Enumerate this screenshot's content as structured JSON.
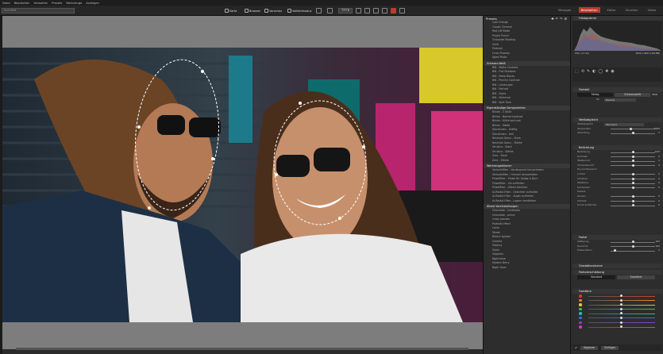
{
  "menu": [
    "Datei",
    "Bearbeiten",
    "Verwalten",
    "Presets",
    "Werkzeuge",
    "Anzeigen"
  ],
  "search": {
    "placeholder": "Suchfeld"
  },
  "toolbar": {
    "karte": "Karte",
    "browser": "Browser",
    "vorschau": "Vorschau",
    "vollbild": "Vollbildmodus",
    "zoom": "TTTTB"
  },
  "modes": [
    "Manager",
    "Bearbeiten",
    "Editor",
    "Drucken",
    "Video"
  ],
  "presets": {
    "title": "Presets",
    "top_items": [
      "Cold Orange",
      "Classic Chrome",
      "Red Lift Matte",
      "Purple Punch",
      "Turquoise Shading",
      "Vivid",
      "Polaroid",
      "Cross Process",
      "Aged Photo"
    ],
    "sections": [
      {
        "title": "Schwarz-Weiß",
        "items": [
          "BW - Matte Contrast",
          "BW - Flat Shadows",
          "BW - Deep Blacks",
          "BW - Punchy Contrast",
          "BW - Landscape",
          "BW - Portrait",
          "BW - Sepia",
          "BW - Selenium",
          "BW - Split Tone"
        ]
      },
      {
        "title": "Eigenständige Komponenten",
        "items": [
          "Blinke - 3 Stufe",
          "Blinke - Normal kontrast",
          "Blinke - Kühle kontrast",
          "Blinke - Matte",
          "Diorahmen - Kräftig",
          "Diorahmen - Hell",
          "Neutrale Gamu - Stark",
          "Neutrale Gamu - Stärke",
          "Struktur - Stark",
          "Struktur - Stärke",
          "Zero - Stark",
          "Zero - Stärke"
        ]
      },
      {
        "title": "Werkzeugaktionen",
        "items": [
          "Verlaufsfilter - Vordergrund hervorheben",
          "Verlaufsfilter - Himmel hervorheben",
          "Pinselfilter - Pinsel für Sodge & Burn",
          "Pinselfilter - Iris aufhellen",
          "Pinselfilter - Zähne bleichen",
          "AI-Radial-Filter - Gesichter aufhellen",
          "AI-Radial-Filter - Augen aufhellen",
          "AI-Radial-Filter - Lippen verstärken"
        ]
      },
      {
        "title": "Ältere Voreinstellungen",
        "items": [
          "Chocolate - kontrastio",
          "Chocolate - prime",
          "Cross process",
          "Polaroid effect",
          "Lomo",
          "Street",
          "Bleach bypass",
          "Cinema",
          "Gloomy",
          "Sepia",
          "Zeppelin",
          "Nightmare",
          "Modern Berry",
          "Night fever"
        ]
      }
    ]
  },
  "right": {
    "histogram_title": "Histogramm",
    "file_info": "PNG  (23:90)",
    "file_dims": "5020 x 960  (1.60 MB)",
    "profile_title": "Farbteil",
    "color_btn": "Farbig",
    "bw_btn": "Schwarzweiß",
    "bw_side": "MOD",
    "filter_label": "RA",
    "filter_value": "Neutral",
    "wb_title": "Weißabgleich",
    "wb_mode_label": "Weißabgleich",
    "wb_mode_value": "Standard",
    "wb_rows": [
      {
        "label": "Temperatur",
        "val": "5000",
        "pos": 0.45
      },
      {
        "label": "Abstufung",
        "val": "0",
        "pos": 0.5
      }
    ],
    "exposure_title": "Belichtung",
    "exposure_rows": [
      {
        "label": "Belichtung",
        "val": "0.00",
        "pos": 0.5
      },
      {
        "label": "Kontrast",
        "val": "0",
        "pos": 0.5
      },
      {
        "label": "Weißpunkt",
        "val": "0",
        "pos": 0.5
      },
      {
        "label": "Schwarzpunkt",
        "val": "0",
        "pos": 0.5
      },
      {
        "label": "Dynamikbereich",
        "val": "",
        "pos": -1
      },
      {
        "label": "Lichter",
        "val": "0",
        "pos": 0.5
      },
      {
        "label": "Schatten",
        "val": "0",
        "pos": 0.5
      },
      {
        "label": "Weißtöne",
        "val": "0",
        "pos": 0.5
      },
      {
        "label": "Schwärzen",
        "val": "0",
        "pos": 0.5
      },
      {
        "label": "Details",
        "val": "",
        "pos": -1
      },
      {
        "label": "Kanten",
        "val": "0",
        "pos": 0.5
      },
      {
        "label": "Klarheit",
        "val": "0",
        "pos": 0.5
      },
      {
        "label": "Dunst entfernen",
        "val": "0",
        "pos": 0.5
      }
    ],
    "color_title": "Farbe",
    "color_rows": [
      {
        "label": "Sättigung",
        "val": "100",
        "pos": 0.5
      },
      {
        "label": "Dynamik",
        "val": "100",
        "pos": 0.5
      },
      {
        "label": "Präsentation",
        "val": "0",
        "pos": 0.1
      }
    ],
    "grad_title": "Gradationskurve",
    "curves_title": "Farbverschiebung",
    "standard_btn": "Standard",
    "extended_btn": "Erweitert",
    "hsl_title": "Farbtöne",
    "hsl_colors": [
      "#d63a2f",
      "#e6862b",
      "#e0d02c",
      "#4cc03c",
      "#31b4b8",
      "#3a6fe0",
      "#8a3fe0",
      "#d83aa8"
    ],
    "bottom_copy": "Kopieren",
    "bottom_paste": "Einfügen"
  }
}
